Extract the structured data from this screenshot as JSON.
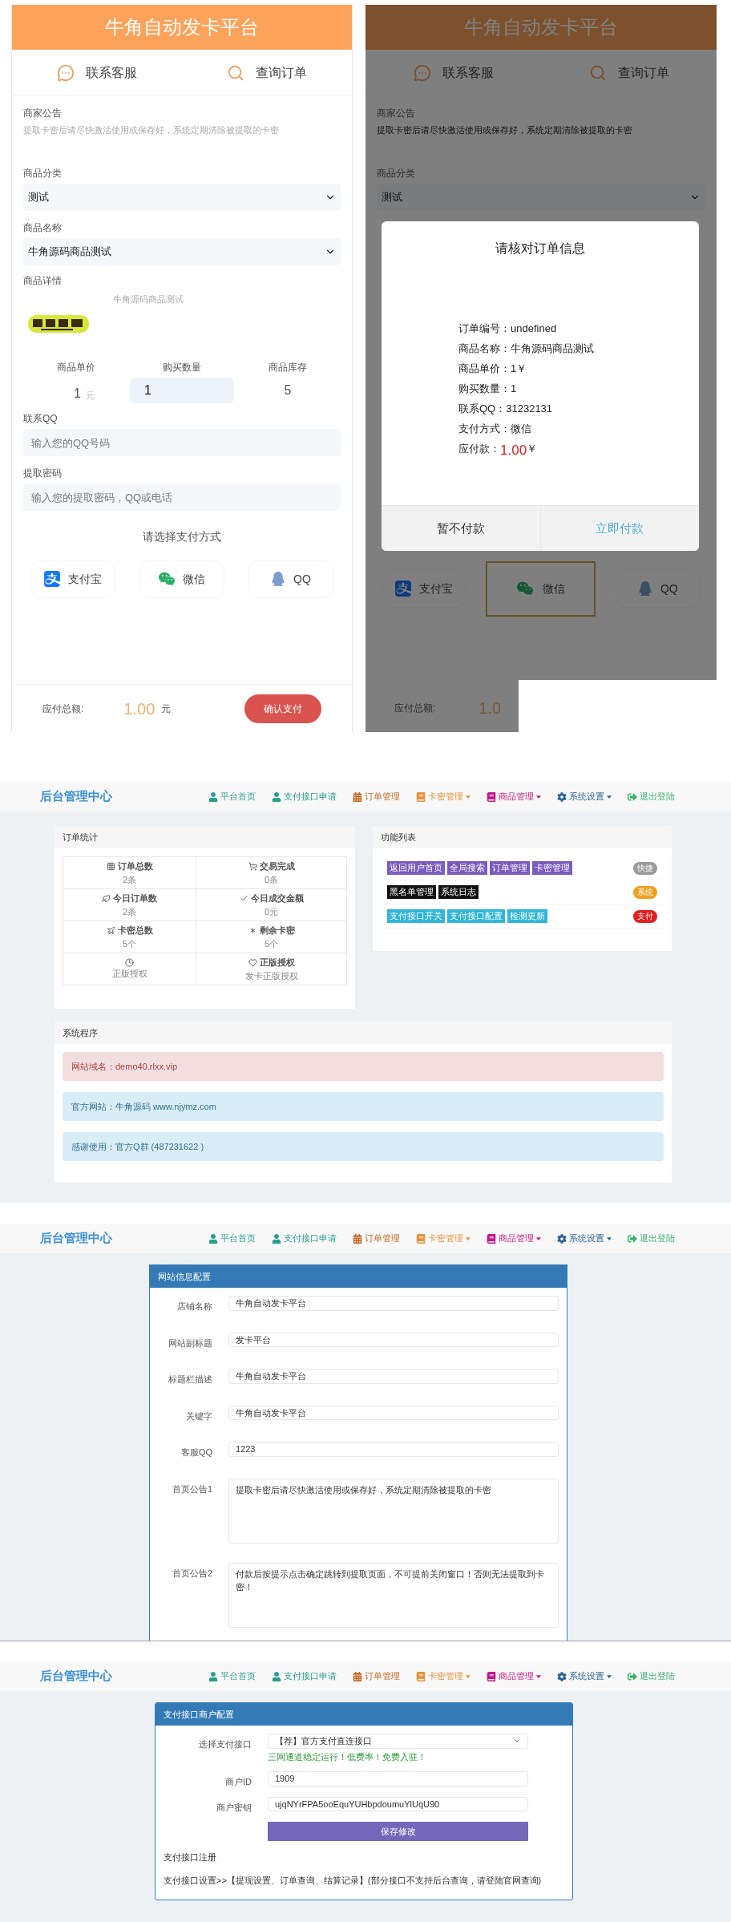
{
  "order_form": {
    "header_title": "牛角自动发卡平台",
    "nav": [
      {
        "label": "联系客服"
      },
      {
        "label": "查询订单"
      }
    ],
    "notice": {
      "label": "商家公告",
      "text": "提取卡密后请尽快激活使用或保存好，系统定期清除被提取的卡密"
    },
    "category": {
      "label": "商品分类",
      "value": "测试"
    },
    "product": {
      "label": "商品名称",
      "value": "牛角源码商品测试"
    },
    "details": {
      "label": "商品详情",
      "description": "牛角源码商品测试"
    },
    "price": {
      "label": "商品单价",
      "value": "1",
      "unit": "元"
    },
    "quantity": {
      "label": "购买数量",
      "value": "1"
    },
    "stock": {
      "label": "商品库存",
      "value": "5"
    },
    "qq": {
      "label": "联系QQ",
      "placeholder": "输入您的QQ号码"
    },
    "password": {
      "label": "提取密码",
      "placeholder": "输入您的提取密码，QQ或电话"
    },
    "payment_prompt": "请选择支付方式",
    "payment_methods": [
      {
        "label": "支付宝",
        "selected": false
      },
      {
        "label": "微信",
        "selected": false
      },
      {
        "label": "QQ",
        "selected": false
      }
    ],
    "total": {
      "label": "应付总额:",
      "amount": "1.00",
      "unit": "元"
    },
    "confirm_button": "确认支付"
  },
  "order_confirm": {
    "header_title": "牛角自动发卡平台",
    "nav": [
      {
        "label": "联系客服"
      },
      {
        "label": "查询订单"
      }
    ],
    "notice": {
      "label": "商家公告",
      "text": "提取卡密后请尽快激活使用或保存好，系统定期清除被提取的卡密"
    },
    "category": {
      "label": "商品分类",
      "value": "测试"
    },
    "payment_methods": [
      {
        "label": "支付宝",
        "selected": false
      },
      {
        "label": "微信",
        "selected": true
      },
      {
        "label": "QQ",
        "selected": false
      }
    ],
    "total": {
      "label": "应付总额:",
      "amount": "1.0"
    },
    "dialog": {
      "title": "请核对订单信息",
      "rows": [
        {
          "label": "订单编号：",
          "value": "undefined"
        },
        {
          "label": "商品名称：",
          "value": "牛角源码商品测试"
        },
        {
          "label": "商品单价：",
          "value": "1￥"
        },
        {
          "label": "购买数量：",
          "value": "1"
        },
        {
          "label": "联系QQ：",
          "value": "31232131"
        },
        {
          "label": "支付方式：",
          "value": "微信"
        }
      ],
      "amount_label": "应付款：",
      "amount": "1.00",
      "amount_unit": "￥",
      "buttons": [
        "暂不付款",
        "立即付款"
      ]
    }
  },
  "dashboard": {
    "navbar": {
      "brand": "后台管理中心",
      "items": [
        {
          "label": "平台首页",
          "color": "#2a9d8f",
          "dropdown": false
        },
        {
          "label": "支付接口申请",
          "color": "#2a9d8f",
          "dropdown": false
        },
        {
          "label": "订单管理",
          "color": "#c0661e",
          "dropdown": false
        },
        {
          "label": "卡密管理",
          "color": "#e8913a",
          "dropdown": true
        },
        {
          "label": "商品管理",
          "color": "#c0188a",
          "dropdown": true
        },
        {
          "label": "系统设置",
          "color": "#2a6496",
          "dropdown": true
        },
        {
          "label": "退出登陆",
          "color": "#3cb371",
          "dropdown": false
        }
      ]
    },
    "order_stats": {
      "title": "订单统计",
      "items": [
        {
          "title": "订单总数",
          "value": "2条"
        },
        {
          "title": "交易完成",
          "value": "0条"
        },
        {
          "title": "今日订单数",
          "value": "2条"
        },
        {
          "title": "今日成交金额",
          "value": "0元"
        },
        {
          "title": "卡密总数",
          "value": "5个"
        },
        {
          "title": "剩余卡密",
          "value": "5个"
        },
        {
          "value": "正版授权"
        },
        {
          "title": "正版授权",
          "value": "发卡正版授权"
        }
      ]
    },
    "features": {
      "title": "功能列表",
      "rows": [
        {
          "color": "#7a5bbd",
          "badges": [
            "返回用户首页",
            "全局搜索",
            "订单管理",
            "卡密管理"
          ],
          "tag": {
            "label": "快捷",
            "color": "#9a9a9a"
          }
        },
        {
          "color": "#111111",
          "badges": [
            "黑名单管理",
            "系统日志"
          ],
          "tag": {
            "label": "系统",
            "color": "#f0a020"
          }
        },
        {
          "color": "#2fb5d8",
          "badges": [
            "支付接口开关",
            "支付接口配置",
            "检测更新"
          ],
          "tag": {
            "label": "支付",
            "color": "#e0201e"
          }
        }
      ]
    },
    "system": {
      "title": "系统程序",
      "alerts": [
        {
          "kind": "danger",
          "text": "网站域名：demo40.rlxx.vip"
        },
        {
          "kind": "info",
          "text": "官方网站：牛角源码 www.njymz.com"
        },
        {
          "kind": "info",
          "text": "感谢使用：官方Q群 (487231622 )"
        }
      ]
    }
  },
  "site_settings": {
    "navbar": {
      "brand": "后台管理中心",
      "items": [
        {
          "label": "平台首页",
          "color": "#2a9d8f",
          "dropdown": false
        },
        {
          "label": "支付接口申请",
          "color": "#2a9d8f",
          "dropdown": false
        },
        {
          "label": "订单管理",
          "color": "#c0661e",
          "dropdown": false
        },
        {
          "label": "卡密管理",
          "color": "#e8913a",
          "dropdown": true
        },
        {
          "label": "商品管理",
          "color": "#c0188a",
          "dropdown": true
        },
        {
          "label": "系统设置",
          "color": "#2a6496",
          "dropdown": true
        },
        {
          "label": "退出登陆",
          "color": "#3cb371",
          "dropdown": false
        }
      ]
    },
    "title": "网站信息配置",
    "fields": [
      {
        "kind": "input",
        "label": "店铺名称",
        "value": "牛角自动发卡平台"
      },
      {
        "kind": "input",
        "label": "网站副标题",
        "value": "发卡平台"
      },
      {
        "kind": "input",
        "label": "标题栏描述",
        "value": "牛角自动发卡平台"
      },
      {
        "kind": "input",
        "label": "关键字",
        "value": "牛角自动发卡平台"
      },
      {
        "kind": "input",
        "label": "客服QQ",
        "value": "1223"
      },
      {
        "kind": "textarea",
        "label": "首页公告1",
        "value": "提取卡密后请尽快激活使用或保存好，系统定期清除被提取的卡密"
      },
      {
        "kind": "textarea",
        "label": "首页公告2",
        "value": "付款后按提示点击确定跳转到提取页面，不可提前关闭窗口！否则无法提取到卡密！"
      }
    ]
  },
  "payment_settings": {
    "navbar": {
      "brand": "后台管理中心",
      "items": [
        {
          "label": "平台首页",
          "color": "#2a9d8f",
          "dropdown": false
        },
        {
          "label": "支付接口申请",
          "color": "#2a9d8f",
          "dropdown": false
        },
        {
          "label": "订单管理",
          "color": "#c0661e",
          "dropdown": false
        },
        {
          "label": "卡密管理",
          "color": "#e8913a",
          "dropdown": true
        },
        {
          "label": "商品管理",
          "color": "#c0188a",
          "dropdown": true
        },
        {
          "label": "系统设置",
          "color": "#2a6496",
          "dropdown": true
        },
        {
          "label": "退出登陆",
          "color": "#3cb371",
          "dropdown": false
        }
      ]
    },
    "title": "支付接口商户配置",
    "fields": [
      {
        "kind": "select",
        "label": "选择支付接口",
        "value": "【荐】官方支付直连接口",
        "hint": "三网通道稳定运行！低费率！免费入驻！"
      },
      {
        "kind": "input",
        "label": "商户ID",
        "value": "1909"
      },
      {
        "kind": "input",
        "label": "商户密钥",
        "value": "ujqNYrFPA5ooEquYUHbpdoumuYlUqU90"
      }
    ],
    "save_button": "保存修改",
    "register_link": "支付接口注册",
    "footer_text": "支付接口设置>>【提现设置、订单查询、结算记录】(部分接口不支持后台查询，请登陆官网查询)"
  }
}
